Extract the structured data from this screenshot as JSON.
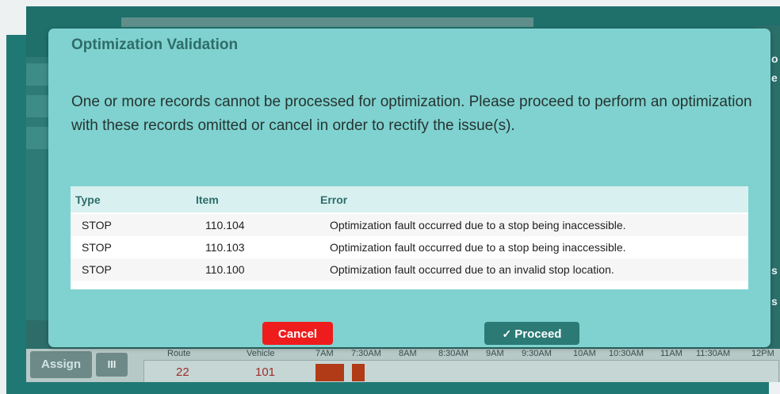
{
  "background_app": {
    "side_letters": [
      "o",
      "e",
      "s",
      "s"
    ],
    "assign_label": "Assign",
    "grid_label": "III",
    "timeline_headers": [
      "Route",
      "Vehicle",
      "7AM",
      "7:30AM",
      "8AM",
      "8:30AM",
      "9AM",
      "9:30AM",
      "10AM",
      "10:30AM",
      "11AM",
      "11:30AM",
      "12PM"
    ],
    "timeline_row": {
      "route": "22",
      "vehicle": "101"
    }
  },
  "modal": {
    "title": "Optimization Validation",
    "message": "One or more records cannot be processed for optimization. Please proceed to perform an optimization with these records omitted or cancel in order to rectify the issue(s).",
    "table": {
      "headers": {
        "type": "Type",
        "item": "Item",
        "error": "Error"
      },
      "rows": [
        {
          "type": "STOP",
          "item": "110.104",
          "error": "Optimization fault occurred due to a stop being inaccessible."
        },
        {
          "type": "STOP",
          "item": "110.103",
          "error": "Optimization fault occurred due to a stop being inaccessible."
        },
        {
          "type": "STOP",
          "item": "110.100",
          "error": "Optimization fault occurred due to an invalid stop location."
        }
      ]
    },
    "buttons": {
      "cancel": "Cancel",
      "proceed": "Proceed",
      "proceed_icon": "check-icon"
    }
  },
  "colors": {
    "accent_teal": "#2bb0ac",
    "modal_bg": "#7fd2cf",
    "title_color": "#2e6d6a",
    "cancel_red": "#ee1c1c",
    "proceed_teal": "#2b7a76"
  }
}
